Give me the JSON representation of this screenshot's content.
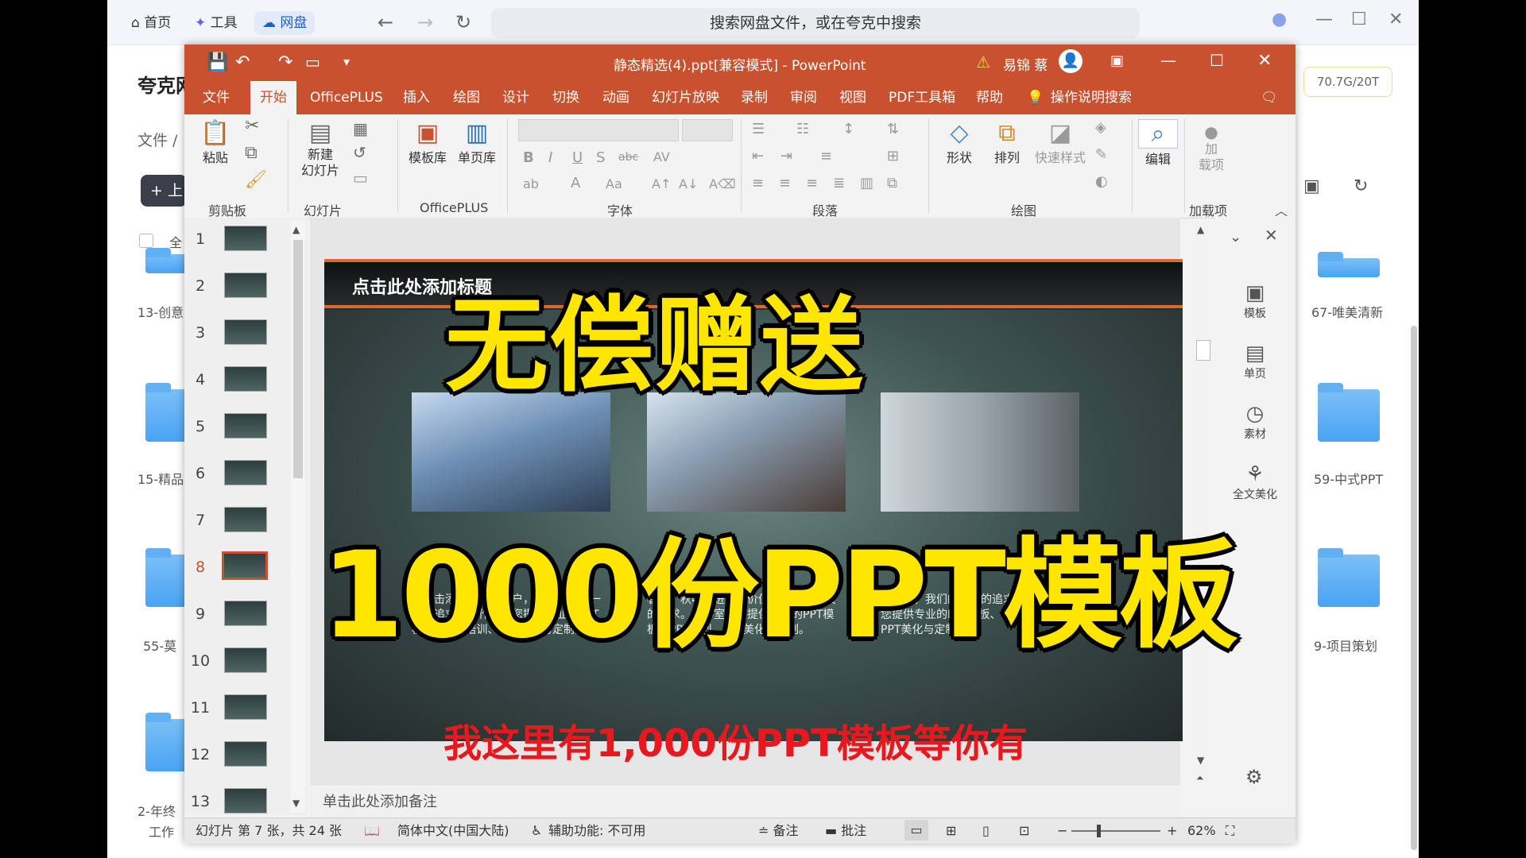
{
  "browser": {
    "tabs": [
      "首页",
      "工具",
      "网盘"
    ],
    "search_placeholder": "搜索网盘文件，或在夸克中搜索",
    "sidebar_title": "夸克网",
    "breadcrumb": "文件 /",
    "upload_label": "+ 上",
    "select_all": "全",
    "storage": "70.7G/20T",
    "folders_left": [
      "13-创意",
      "15-精品",
      "55-莫",
      "2-年终",
      "工作"
    ],
    "folders_right": [
      "67-唯美清新",
      "59-中式PPT",
      "9-项目策划"
    ]
  },
  "ppt": {
    "title": "静态精选(4).ppt[兼容模式]  -  PowerPoint",
    "user": "易锦 蔡",
    "menu": [
      "文件",
      "开始",
      "OfficePLUS",
      "插入",
      "绘图",
      "设计",
      "切换",
      "动画",
      "幻灯片放映",
      "录制",
      "审阅",
      "视图",
      "PDF工具箱",
      "帮助",
      "操作说明搜索"
    ],
    "ribbon": {
      "paste": "粘贴",
      "new_slide": "新建\n幻灯片",
      "template_lib": "模板库",
      "single_page_lib": "单页库",
      "shape": "形状",
      "arrange": "排列",
      "quick_style": "快速样式",
      "edit": "编辑",
      "addin": "加\n载项",
      "groups": [
        "剪贴板",
        "幻灯片",
        "OfficePLUS",
        "字体",
        "段落",
        "绘图",
        "加载项"
      ]
    },
    "thumbnails": [
      "1",
      "2",
      "3",
      "4",
      "5",
      "6",
      "7",
      "8",
      "9",
      "10",
      "11",
      "12",
      "13"
    ],
    "selected_thumbnail": "8",
    "slide": {
      "header_text": "点击此处添加标题",
      "col1_text": "，点击添加。成就客户，实现我们的一贯的追求。工作室为您提供专业的PPT模板、PPT培训、PPT美化与定制。",
      "col2_text": "春种，秋收，进步，价值是我们的一贯的追求。工作室为您提供专业的PPT模板、PPT培训、PPT美化与定制。",
      "col3_text": "工作室，我们的一贯的追求。工作室为您提供专业的PPT模板、PPT培训、PPT美化与定制。"
    },
    "notes_placeholder": "单击此处添加备注",
    "task_pane": [
      "模板",
      "单页",
      "素材",
      "全文美化"
    ],
    "status": {
      "slide_info": "幻灯片 第 7 张，共 24 张",
      "language": "简体中文(中国大陆)",
      "accessibility": "辅助功能: 不可用",
      "notes": "备注",
      "comments": "批注",
      "zoom": "62%"
    }
  },
  "overlay": {
    "line1": "无偿赠送",
    "line2": "1000份PPT模板",
    "caption": "我这里有1,000份PPT模板等你有"
  },
  "colors": {
    "ppt_accent": "#c8522f",
    "overlay_yellow": "#ffe600",
    "caption_red": "#e8181e"
  }
}
